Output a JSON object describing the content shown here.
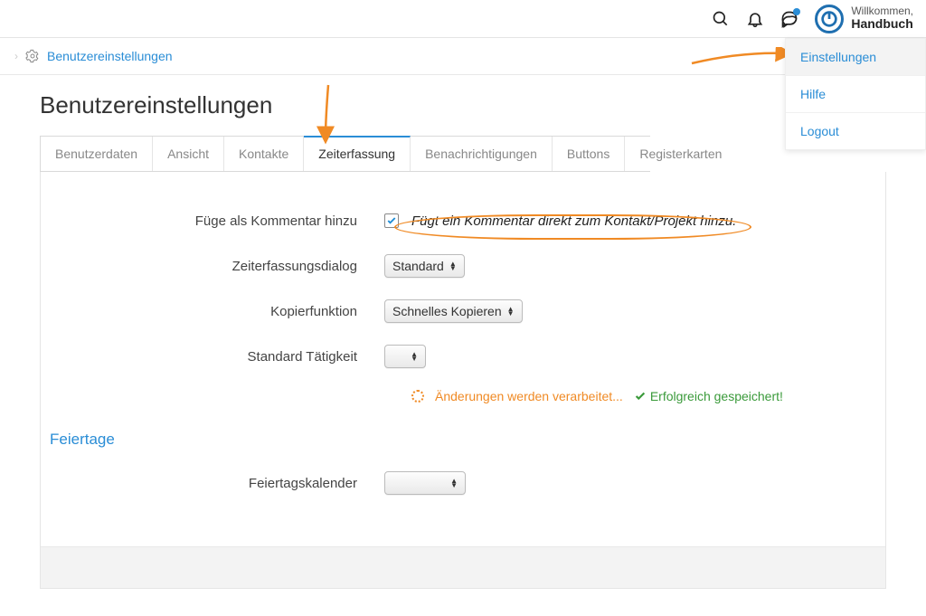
{
  "header": {
    "welcome_label": "Willkommen,",
    "user_name": "Handbuch"
  },
  "breadcrumb": {
    "link": "Benutzereinstellungen"
  },
  "user_menu": {
    "items": [
      {
        "label": "Einstellungen",
        "active": true
      },
      {
        "label": "Hilfe",
        "active": false
      },
      {
        "label": "Logout",
        "active": false
      }
    ]
  },
  "page": {
    "title": "Benutzereinstellungen"
  },
  "tabs": [
    {
      "label": "Benutzerdaten"
    },
    {
      "label": "Ansicht"
    },
    {
      "label": "Kontakte"
    },
    {
      "label": "Zeiterfassung",
      "active": true
    },
    {
      "label": "Benachrichtigungen"
    },
    {
      "label": "Buttons"
    },
    {
      "label": "Registerkarten"
    }
  ],
  "form": {
    "add_as_comment": {
      "label": "Füge als Kommentar hinzu",
      "checked": true,
      "hint": "Fügt ein Kommentar direkt zum Kontakt/Projekt hinzu."
    },
    "time_dialog": {
      "label": "Zeiterfassungsdialog",
      "value": "Standard"
    },
    "copy_function": {
      "label": "Kopierfunktion",
      "value": "Schnelles Kopieren"
    },
    "default_activity": {
      "label": "Standard Tätigkeit",
      "value": ""
    },
    "status_processing": "Änderungen werden verarbeitet...",
    "status_success": "Erfolgreich gespeichert!",
    "holidays_section": "Feiertage",
    "holiday_calendar": {
      "label": "Feiertagskalender",
      "value": ""
    }
  }
}
